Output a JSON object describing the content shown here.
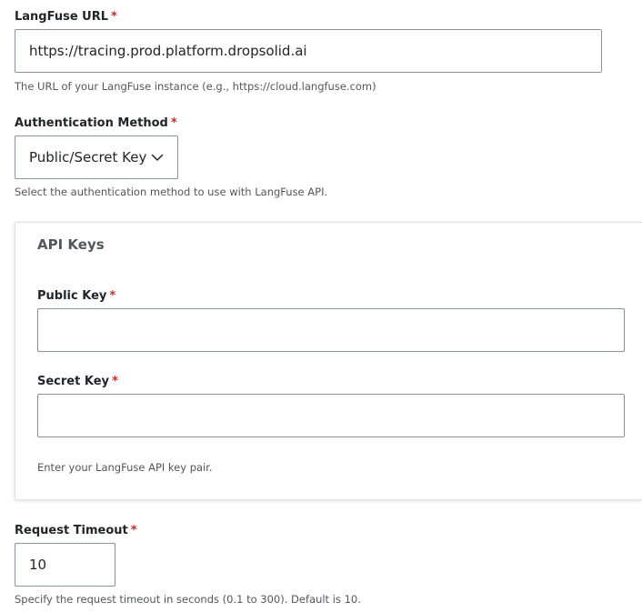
{
  "langfuse_url": {
    "label": "LangFuse URL",
    "required_mark": "*",
    "value": "https://tracing.prod.platform.dropsolid.ai",
    "description": "The URL of your LangFuse instance (e.g., https://cloud.langfuse.com)"
  },
  "auth_method": {
    "label": "Authentication Method",
    "required_mark": "*",
    "selected": "Public/Secret Key",
    "description": "Select the authentication method to use with LangFuse API."
  },
  "api_keys": {
    "legend": "API Keys",
    "public_key": {
      "label": "Public Key",
      "required_mark": "*",
      "value": ""
    },
    "secret_key": {
      "label": "Secret Key",
      "required_mark": "*",
      "value": ""
    },
    "description": "Enter your LangFuse API key pair."
  },
  "request_timeout": {
    "label": "Request Timeout",
    "required_mark": "*",
    "value": "10",
    "description": "Specify the request timeout in seconds (0.1 to 300). Default is 10."
  },
  "colors": {
    "required": "#dc2323",
    "border": "#8e929c",
    "text": "#232429",
    "muted": "#55565b"
  },
  "icons": {
    "select_arrow": "chevron-down-icon"
  }
}
